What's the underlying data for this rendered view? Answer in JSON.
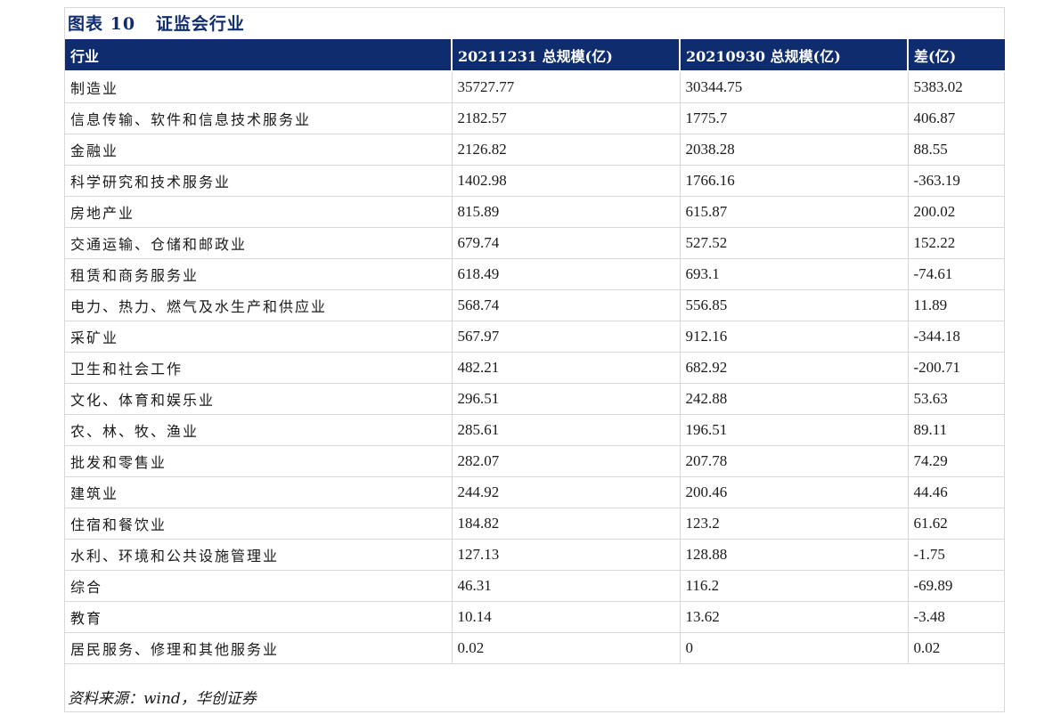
{
  "title": "图表 10   证监会行业",
  "table": {
    "headers": [
      "行业",
      "20211231 总规模(亿)",
      "20210930 总规模(亿)",
      "差(亿)"
    ],
    "rows": [
      {
        "industry": "制造业",
        "dec": "35727.77",
        "sep": "30344.75",
        "diff": "5383.02"
      },
      {
        "industry": "信息传输、软件和信息技术服务业",
        "dec": "2182.57",
        "sep": "1775.7",
        "diff": "406.87"
      },
      {
        "industry": "金融业",
        "dec": "2126.82",
        "sep": "2038.28",
        "diff": "88.55"
      },
      {
        "industry": "科学研究和技术服务业",
        "dec": "1402.98",
        "sep": "1766.16",
        "diff": "-363.19"
      },
      {
        "industry": "房地产业",
        "dec": "815.89",
        "sep": "615.87",
        "diff": "200.02"
      },
      {
        "industry": "交通运输、仓储和邮政业",
        "dec": "679.74",
        "sep": "527.52",
        "diff": "152.22"
      },
      {
        "industry": "租赁和商务服务业",
        "dec": "618.49",
        "sep": "693.1",
        "diff": "-74.61"
      },
      {
        "industry": "电力、热力、燃气及水生产和供应业",
        "dec": "568.74",
        "sep": "556.85",
        "diff": "11.89"
      },
      {
        "industry": "采矿业",
        "dec": "567.97",
        "sep": "912.16",
        "diff": "-344.18"
      },
      {
        "industry": "卫生和社会工作",
        "dec": "482.21",
        "sep": "682.92",
        "diff": "-200.71"
      },
      {
        "industry": "文化、体育和娱乐业",
        "dec": "296.51",
        "sep": "242.88",
        "diff": "53.63"
      },
      {
        "industry": "农、林、牧、渔业",
        "dec": "285.61",
        "sep": "196.51",
        "diff": "89.11"
      },
      {
        "industry": "批发和零售业",
        "dec": "282.07",
        "sep": "207.78",
        "diff": "74.29"
      },
      {
        "industry": "建筑业",
        "dec": "244.92",
        "sep": "200.46",
        "diff": "44.46"
      },
      {
        "industry": "住宿和餐饮业",
        "dec": "184.82",
        "sep": "123.2",
        "diff": "61.62"
      },
      {
        "industry": "水利、环境和公共设施管理业",
        "dec": "127.13",
        "sep": "128.88",
        "diff": "-1.75"
      },
      {
        "industry": "综合",
        "dec": "46.31",
        "sep": "116.2",
        "diff": "-69.89"
      },
      {
        "industry": "教育",
        "dec": "10.14",
        "sep": "13.62",
        "diff": "-3.48"
      },
      {
        "industry": "居民服务、修理和其他服务业",
        "dec": "0.02",
        "sep": "0",
        "diff": "0.02"
      }
    ]
  },
  "source": "资料来源：wind，华创证券",
  "colors": {
    "header_bg": "#0f2d6e",
    "title": "#0f2d6e",
    "grid": "#d9d9d9"
  }
}
